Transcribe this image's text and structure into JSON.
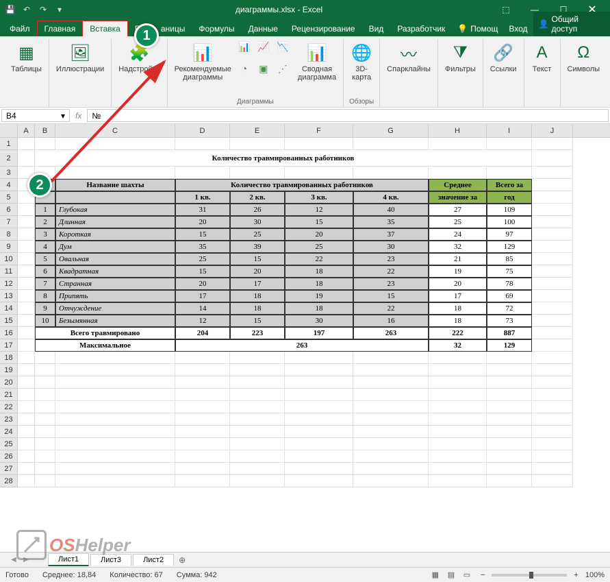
{
  "app": {
    "title": "диаграммы.xlsx - Excel"
  },
  "tabs": {
    "file": "Файл",
    "home": "Главная",
    "insert": "Вставка",
    "r": "Р",
    "pagelayout_frag": "аницы",
    "formulas": "Формулы",
    "data": "Данные",
    "review": "Рецензирование",
    "view": "Вид",
    "developer": "Разработчик",
    "help": "Помощ",
    "login": "Вход",
    "share": "Общий доступ"
  },
  "ribbon": {
    "tables": "Таблицы",
    "illustrations": "Иллюстрации",
    "addins": "Надстройки",
    "recommended": "Рекомендуемые\nдиаграммы",
    "charts_group": "Диаграммы",
    "pivotchart": "Сводная\nдиаграмма",
    "map3d": "3D-\nкарта",
    "tours": "Обзоры",
    "sparklines": "Спарклайны",
    "filters": "Фильтры",
    "links": "Ссылки",
    "text": "Текст",
    "symbols": "Символы"
  },
  "namebox": "B4",
  "formula": "№",
  "columns": [
    "A",
    "B",
    "C",
    "D",
    "E",
    "F",
    "G",
    "H",
    "I",
    "J"
  ],
  "title_text": "Количество травмированных работников",
  "headers": {
    "num": "№",
    "name": "Название шахты",
    "count_title": "Количество травмированных работников",
    "q1": "1 кв.",
    "q2": "2 кв.",
    "q3": "3 кв.",
    "q4": "4 кв.",
    "avg_l1": "Среднее",
    "avg_l2": "значение за",
    "total_l1": "Всего за",
    "total_l2": "год"
  },
  "rows": [
    {
      "n": "1",
      "name": "Глубокая",
      "q": [
        31,
        26,
        12,
        40
      ],
      "avg": 27,
      "tot": 109
    },
    {
      "n": "2",
      "name": "Длинная",
      "q": [
        20,
        30,
        15,
        35
      ],
      "avg": 25,
      "tot": 100
    },
    {
      "n": "3",
      "name": "Короткая",
      "q": [
        15,
        25,
        20,
        37
      ],
      "avg": 24,
      "tot": 97
    },
    {
      "n": "4",
      "name": "Дум",
      "q": [
        35,
        39,
        25,
        30
      ],
      "avg": 32,
      "tot": 129
    },
    {
      "n": "5",
      "name": "Овальная",
      "q": [
        25,
        15,
        22,
        23
      ],
      "avg": 21,
      "tot": 85
    },
    {
      "n": "6",
      "name": "Квадратная",
      "q": [
        15,
        20,
        18,
        22
      ],
      "avg": 19,
      "tot": 75
    },
    {
      "n": "7",
      "name": "Странная",
      "q": [
        20,
        17,
        18,
        23
      ],
      "avg": 20,
      "tot": 78
    },
    {
      "n": "8",
      "name": "Припять",
      "q": [
        17,
        18,
        19,
        15
      ],
      "avg": 17,
      "tot": 69
    },
    {
      "n": "9",
      "name": "Отчуждение",
      "q": [
        14,
        18,
        18,
        22
      ],
      "avg": 18,
      "tot": 72
    },
    {
      "n": "10",
      "name": "Безымянная",
      "q": [
        12,
        15,
        30,
        16
      ],
      "avg": 18,
      "tot": 73
    }
  ],
  "summary": {
    "total_label": "Всего травмировано",
    "totals": [
      204,
      223,
      197,
      263
    ],
    "avg": 222,
    "year": 887,
    "max_label": "Максимальное",
    "max_val": 263,
    "max_avg": 32,
    "max_year": 129
  },
  "sheets": {
    "s1": "Лист1",
    "s3": "Лист3",
    "s2": "Лист2"
  },
  "status": {
    "ready": "Готово",
    "avg_label": "Среднее:",
    "avg": "18,84",
    "count_label": "Количество:",
    "count": "67",
    "sum_label": "Сумма:",
    "sum": "942",
    "zoom": "100%"
  },
  "watermark": {
    "os": "OS",
    "helper": "Helper"
  },
  "callouts": {
    "one": "1",
    "two": "2"
  }
}
